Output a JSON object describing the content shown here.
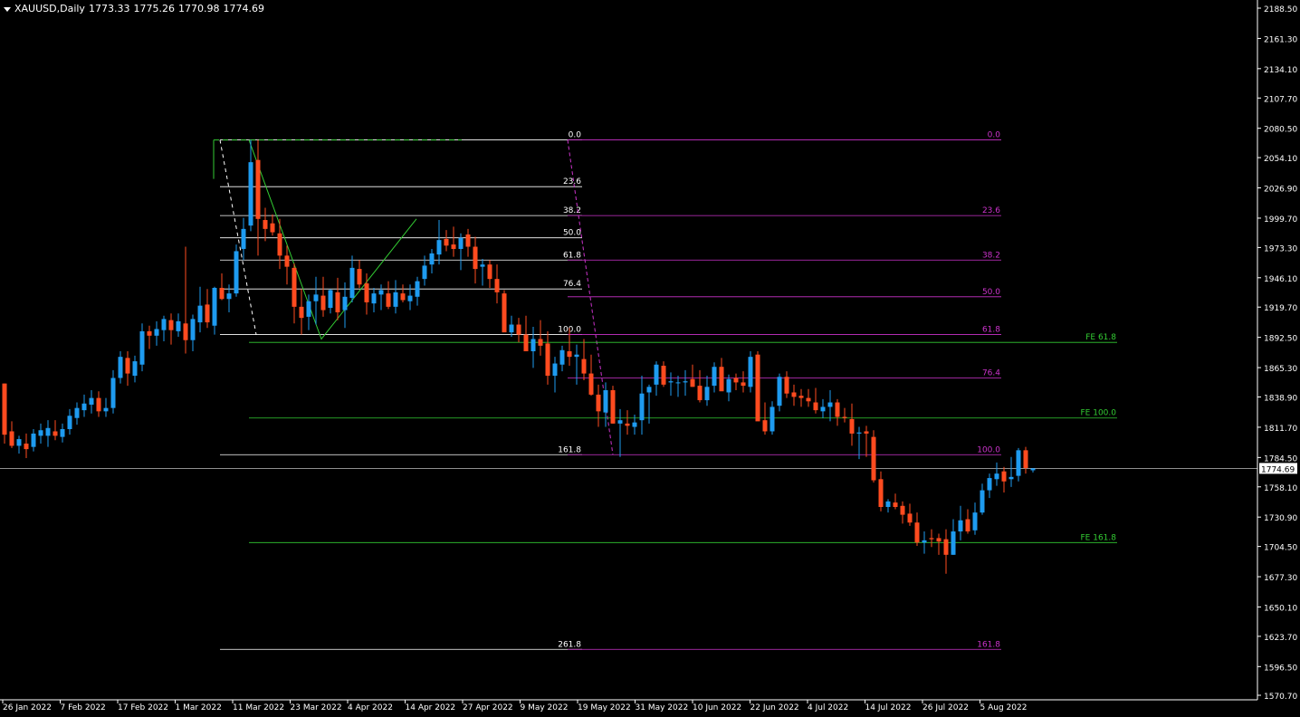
{
  "header": {
    "symbol": "XAUUSD,Daily",
    "open": "1773.33",
    "high": "1775.26",
    "low": "1770.98",
    "close": "1774.69"
  },
  "colors": {
    "background": "#000000",
    "bull": "#1e9bf0",
    "bear": "#ff4b1f",
    "fib": "#ffffff",
    "fib_ext": "#cc33cc",
    "fe": "#33cc33",
    "axis": "#ffffff",
    "price_line": "#c0c0c0"
  },
  "chart_data": {
    "type": "candlestick",
    "title": "XAUUSD,Daily",
    "ylim": [
      1570.7,
      2188.5
    ],
    "y_ticks": [
      "2188.50",
      "2161.30",
      "2134.10",
      "2107.70",
      "2080.50",
      "2054.10",
      "2026.90",
      "1999.70",
      "1973.30",
      "1946.10",
      "1919.70",
      "1892.50",
      "1865.30",
      "1838.90",
      "1811.70",
      "1784.50",
      "1758.10",
      "1730.90",
      "1704.50",
      "1677.30",
      "1650.10",
      "1623.70",
      "1596.50",
      "1570.70"
    ],
    "x_ticks": [
      "26 Jan 2022",
      "7 Feb 2022",
      "17 Feb 2022",
      "1 Mar 2022",
      "11 Mar 2022",
      "23 Mar 2022",
      "4 Apr 2022",
      "14 Apr 2022",
      "27 Apr 2022",
      "9 May 2022",
      "19 May 2022",
      "31 May 2022",
      "10 Jun 2022",
      "22 Jun 2022",
      "4 Jul 2022",
      "14 Jul 2022",
      "26 Jul 2022",
      "5 Aug 2022"
    ],
    "current_price": "1774.69",
    "candles": [
      [
        1851,
        1851,
        1797,
        1805
      ],
      [
        1808,
        1817,
        1793,
        1795
      ],
      [
        1795,
        1804,
        1788,
        1801
      ],
      [
        1797,
        1806,
        1784,
        1792
      ],
      [
        1794,
        1810,
        1790,
        1806
      ],
      [
        1804,
        1815,
        1797,
        1809
      ],
      [
        1804,
        1818,
        1794,
        1811
      ],
      [
        1808,
        1818,
        1800,
        1804
      ],
      [
        1803,
        1815,
        1798,
        1810
      ],
      [
        1810,
        1828,
        1805,
        1822
      ],
      [
        1820,
        1834,
        1814,
        1829
      ],
      [
        1827,
        1841,
        1821,
        1833
      ],
      [
        1832,
        1845,
        1824,
        1838
      ],
      [
        1838,
        1844,
        1821,
        1826
      ],
      [
        1826,
        1838,
        1821,
        1829
      ],
      [
        1829,
        1863,
        1824,
        1856
      ],
      [
        1856,
        1880,
        1851,
        1875
      ],
      [
        1874,
        1880,
        1849,
        1860
      ],
      [
        1858,
        1876,
        1852,
        1871
      ],
      [
        1868,
        1905,
        1862,
        1898
      ],
      [
        1898,
        1903,
        1882,
        1894
      ],
      [
        1894,
        1907,
        1885,
        1900
      ],
      [
        1899,
        1912,
        1889,
        1909
      ],
      [
        1908,
        1914,
        1886,
        1899
      ],
      [
        1898,
        1914,
        1893,
        1907
      ],
      [
        1905,
        1974,
        1878,
        1890
      ],
      [
        1890,
        1913,
        1880,
        1909
      ],
      [
        1906,
        1938,
        1897,
        1921
      ],
      [
        1922,
        1936,
        1901,
        1906
      ],
      [
        1903,
        1938,
        1895,
        1937
      ],
      [
        1937,
        1950,
        1926,
        1927
      ],
      [
        1927,
        1940,
        1915,
        1932
      ],
      [
        1932,
        1976,
        1929,
        1970
      ],
      [
        1972,
        2000,
        1962,
        1990
      ],
      [
        1993,
        2070,
        1988,
        2050
      ],
      [
        2052,
        2070,
        1966,
        1999
      ],
      [
        1998,
        2009,
        1979,
        1990
      ],
      [
        1995,
        2003,
        1984,
        1987
      ],
      [
        1986,
        1999,
        1954,
        1966
      ],
      [
        1966,
        1975,
        1940,
        1956
      ],
      [
        1955,
        1959,
        1905,
        1920
      ],
      [
        1920,
        1936,
        1895,
        1910
      ],
      [
        1911,
        1931,
        1899,
        1925
      ],
      [
        1925,
        1947,
        1904,
        1931
      ],
      [
        1930,
        1947,
        1911,
        1917
      ],
      [
        1919,
        1936,
        1914,
        1935
      ],
      [
        1933,
        1946,
        1908,
        1915
      ],
      [
        1917,
        1942,
        1901,
        1929
      ],
      [
        1928,
        1966,
        1924,
        1955
      ],
      [
        1954,
        1962,
        1937,
        1940
      ],
      [
        1941,
        1950,
        1913,
        1924
      ],
      [
        1923,
        1937,
        1915,
        1932
      ],
      [
        1931,
        1940,
        1917,
        1935
      ],
      [
        1932,
        1943,
        1918,
        1920
      ],
      [
        1920,
        1944,
        1914,
        1933
      ],
      [
        1932,
        1940,
        1924,
        1926
      ],
      [
        1925,
        1940,
        1917,
        1930
      ],
      [
        1929,
        1947,
        1921,
        1943
      ],
      [
        1945,
        1966,
        1939,
        1957
      ],
      [
        1958,
        1972,
        1950,
        1968
      ],
      [
        1967,
        1998,
        1958,
        1980
      ],
      [
        1981,
        1989,
        1970,
        1975
      ],
      [
        1976,
        1992,
        1965,
        1972
      ],
      [
        1972,
        1986,
        1953,
        1982
      ],
      [
        1985,
        1990,
        1965,
        1974
      ],
      [
        1974,
        1983,
        1941,
        1954
      ],
      [
        1956,
        1963,
        1939,
        1958
      ],
      [
        1958,
        1962,
        1937,
        1945
      ],
      [
        1945,
        1958,
        1923,
        1933
      ],
      [
        1932,
        1935,
        1900,
        1897
      ],
      [
        1897,
        1912,
        1893,
        1904
      ],
      [
        1904,
        1910,
        1888,
        1895
      ],
      [
        1895,
        1912,
        1882,
        1880
      ],
      [
        1880,
        1902,
        1865,
        1891
      ],
      [
        1891,
        1908,
        1876,
        1885
      ],
      [
        1887,
        1898,
        1850,
        1858
      ],
      [
        1858,
        1875,
        1843,
        1869
      ],
      [
        1868,
        1885,
        1862,
        1881
      ],
      [
        1880,
        1901,
        1867,
        1875
      ],
      [
        1875,
        1886,
        1850,
        1877
      ],
      [
        1873,
        1891,
        1854,
        1860
      ],
      [
        1860,
        1877,
        1840,
        1841
      ],
      [
        1841,
        1850,
        1812,
        1826
      ],
      [
        1825,
        1852,
        1812,
        1845
      ],
      [
        1845,
        1849,
        1815,
        1815
      ],
      [
        1815,
        1828,
        1785,
        1818
      ],
      [
        1815,
        1827,
        1805,
        1813
      ],
      [
        1812,
        1823,
        1805,
        1816
      ],
      [
        1818,
        1858,
        1805,
        1842
      ],
      [
        1843,
        1850,
        1815,
        1848
      ],
      [
        1850,
        1871,
        1840,
        1868
      ],
      [
        1867,
        1871,
        1848,
        1850
      ],
      [
        1852,
        1861,
        1840,
        1853
      ],
      [
        1852,
        1858,
        1839,
        1852
      ],
      [
        1852,
        1863,
        1840,
        1853
      ],
      [
        1855,
        1868,
        1848,
        1848
      ],
      [
        1849,
        1863,
        1834,
        1836
      ],
      [
        1836,
        1858,
        1831,
        1848
      ],
      [
        1849,
        1870,
        1843,
        1866
      ],
      [
        1866,
        1874,
        1847,
        1844
      ],
      [
        1843,
        1859,
        1835,
        1855
      ],
      [
        1856,
        1860,
        1845,
        1852
      ],
      [
        1852,
        1862,
        1843,
        1849
      ],
      [
        1848,
        1880,
        1843,
        1875
      ],
      [
        1877,
        1880,
        1818,
        1817
      ],
      [
        1818,
        1834,
        1805,
        1808
      ],
      [
        1808,
        1835,
        1805,
        1830
      ],
      [
        1831,
        1860,
        1826,
        1857
      ],
      [
        1857,
        1862,
        1838,
        1842
      ],
      [
        1843,
        1850,
        1831,
        1839
      ],
      [
        1840,
        1846,
        1830,
        1838
      ],
      [
        1838,
        1846,
        1830,
        1835
      ],
      [
        1834,
        1847,
        1824,
        1827
      ],
      [
        1826,
        1837,
        1820,
        1830
      ],
      [
        1830,
        1845,
        1817,
        1834
      ],
      [
        1834,
        1837,
        1813,
        1821
      ],
      [
        1821,
        1829,
        1816,
        1820
      ],
      [
        1819,
        1833,
        1795,
        1806
      ],
      [
        1806,
        1812,
        1783,
        1807
      ],
      [
        1808,
        1813,
        1785,
        1806
      ],
      [
        1803,
        1809,
        1762,
        1764
      ],
      [
        1765,
        1772,
        1736,
        1740
      ],
      [
        1740,
        1747,
        1735,
        1745
      ],
      [
        1744,
        1752,
        1738,
        1740
      ],
      [
        1741,
        1745,
        1725,
        1733
      ],
      [
        1734,
        1743,
        1723,
        1726
      ],
      [
        1726,
        1735,
        1705,
        1708
      ],
      [
        1708,
        1718,
        1698,
        1710
      ],
      [
        1712,
        1720,
        1704,
        1711
      ],
      [
        1712,
        1716,
        1697,
        1709
      ],
      [
        1711,
        1720,
        1680,
        1697
      ],
      [
        1697,
        1729,
        1697,
        1718
      ],
      [
        1718,
        1741,
        1710,
        1728
      ],
      [
        1729,
        1738,
        1716,
        1718
      ],
      [
        1719,
        1744,
        1715,
        1735
      ],
      [
        1735,
        1761,
        1733,
        1755
      ],
      [
        1755,
        1770,
        1748,
        1766
      ],
      [
        1765,
        1780,
        1759,
        1770
      ],
      [
        1772,
        1776,
        1753,
        1763
      ],
      [
        1765,
        1785,
        1758,
        1767
      ],
      [
        1768,
        1793,
        1763,
        1791
      ],
      [
        1791,
        1794,
        1770,
        1775
      ],
      [
        1773,
        1775,
        1771,
        1774.69
      ]
    ],
    "fibonacci_retracement": {
      "from_price": 2070,
      "to_price": 1895,
      "levels": [
        "0.0",
        "23.6",
        "38.2",
        "50.0",
        "61.8",
        "76.4",
        "100.0",
        "161.8",
        "261.8"
      ],
      "prices": [
        2070,
        2028,
        2002,
        1982,
        1962,
        1936,
        1895,
        1787,
        1612
      ]
    },
    "fibonacci_extension": {
      "levels": [
        "0.0",
        "23.6",
        "38.2",
        "50.0",
        "61.8",
        "76.4",
        "100.0",
        "161.8"
      ],
      "prices": [
        2070,
        2002,
        1962,
        1929,
        1895,
        1856,
        1787,
        1612
      ]
    },
    "fibo_expansion": {
      "levels": [
        "FE 61.8",
        "FE 100.0",
        "FE 161.8"
      ],
      "prices": [
        1888,
        1820,
        1708
      ]
    }
  }
}
